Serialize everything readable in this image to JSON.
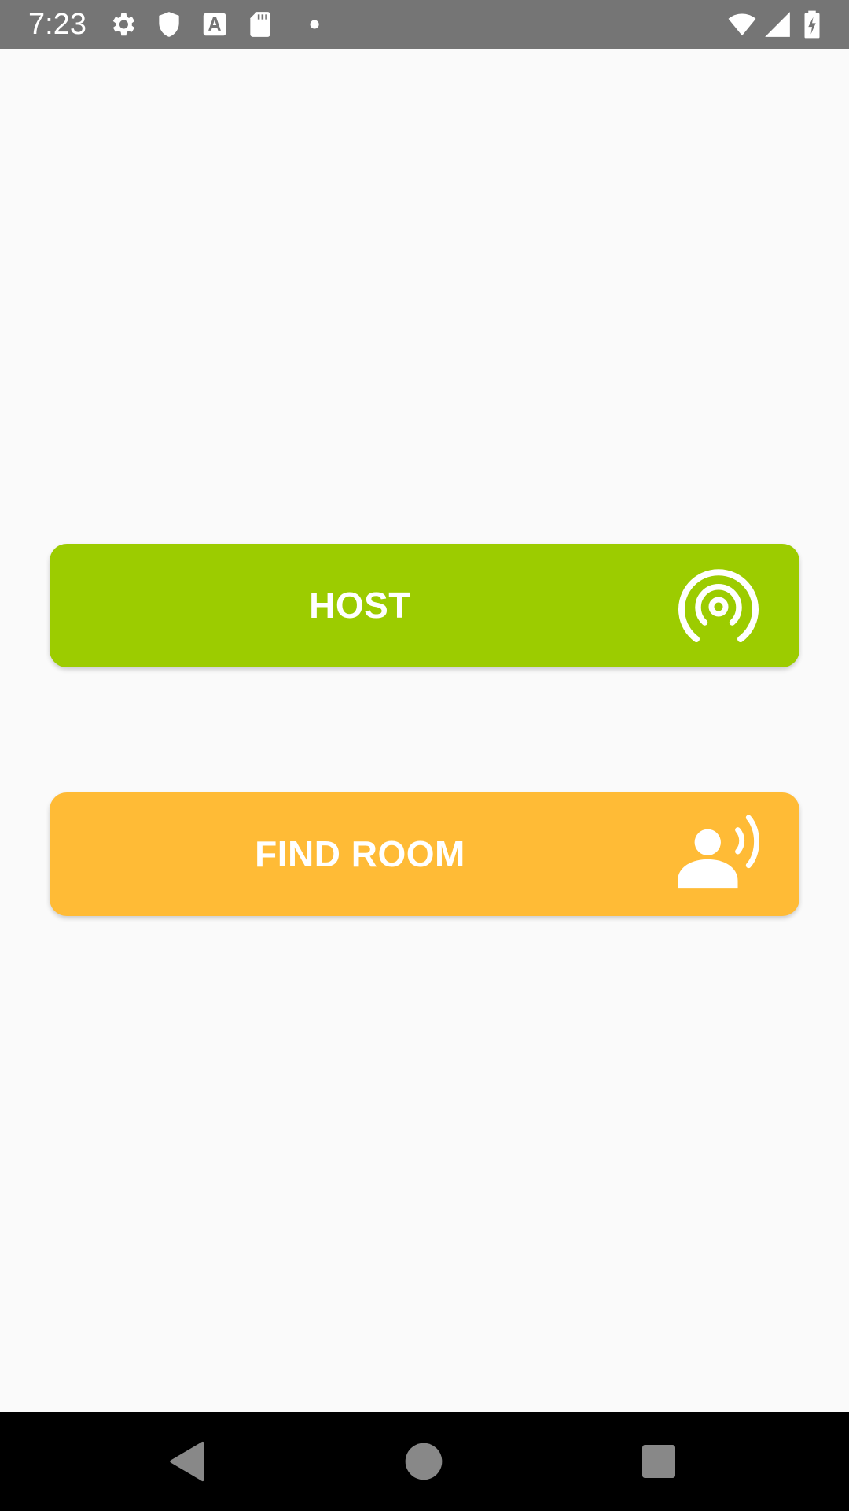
{
  "status_bar": {
    "time": "7:23",
    "icons_left": [
      "settings-icon",
      "shield-icon",
      "text-a-icon",
      "sd-card-icon",
      "dot-icon"
    ],
    "icons_right": [
      "wifi-icon",
      "cell-signal-icon",
      "battery-charging-icon"
    ],
    "background": "#757575"
  },
  "main": {
    "host_button": {
      "label": "HOST",
      "icon": "broadcast-icon",
      "color": "#9ccc00"
    },
    "find_room_button": {
      "label": "FIND ROOM",
      "icon": "person-voice-icon",
      "color": "#ffbb36"
    }
  },
  "nav_bar": {
    "buttons": [
      "back-icon",
      "home-icon",
      "recents-icon"
    ],
    "icon_color": "#888888"
  }
}
